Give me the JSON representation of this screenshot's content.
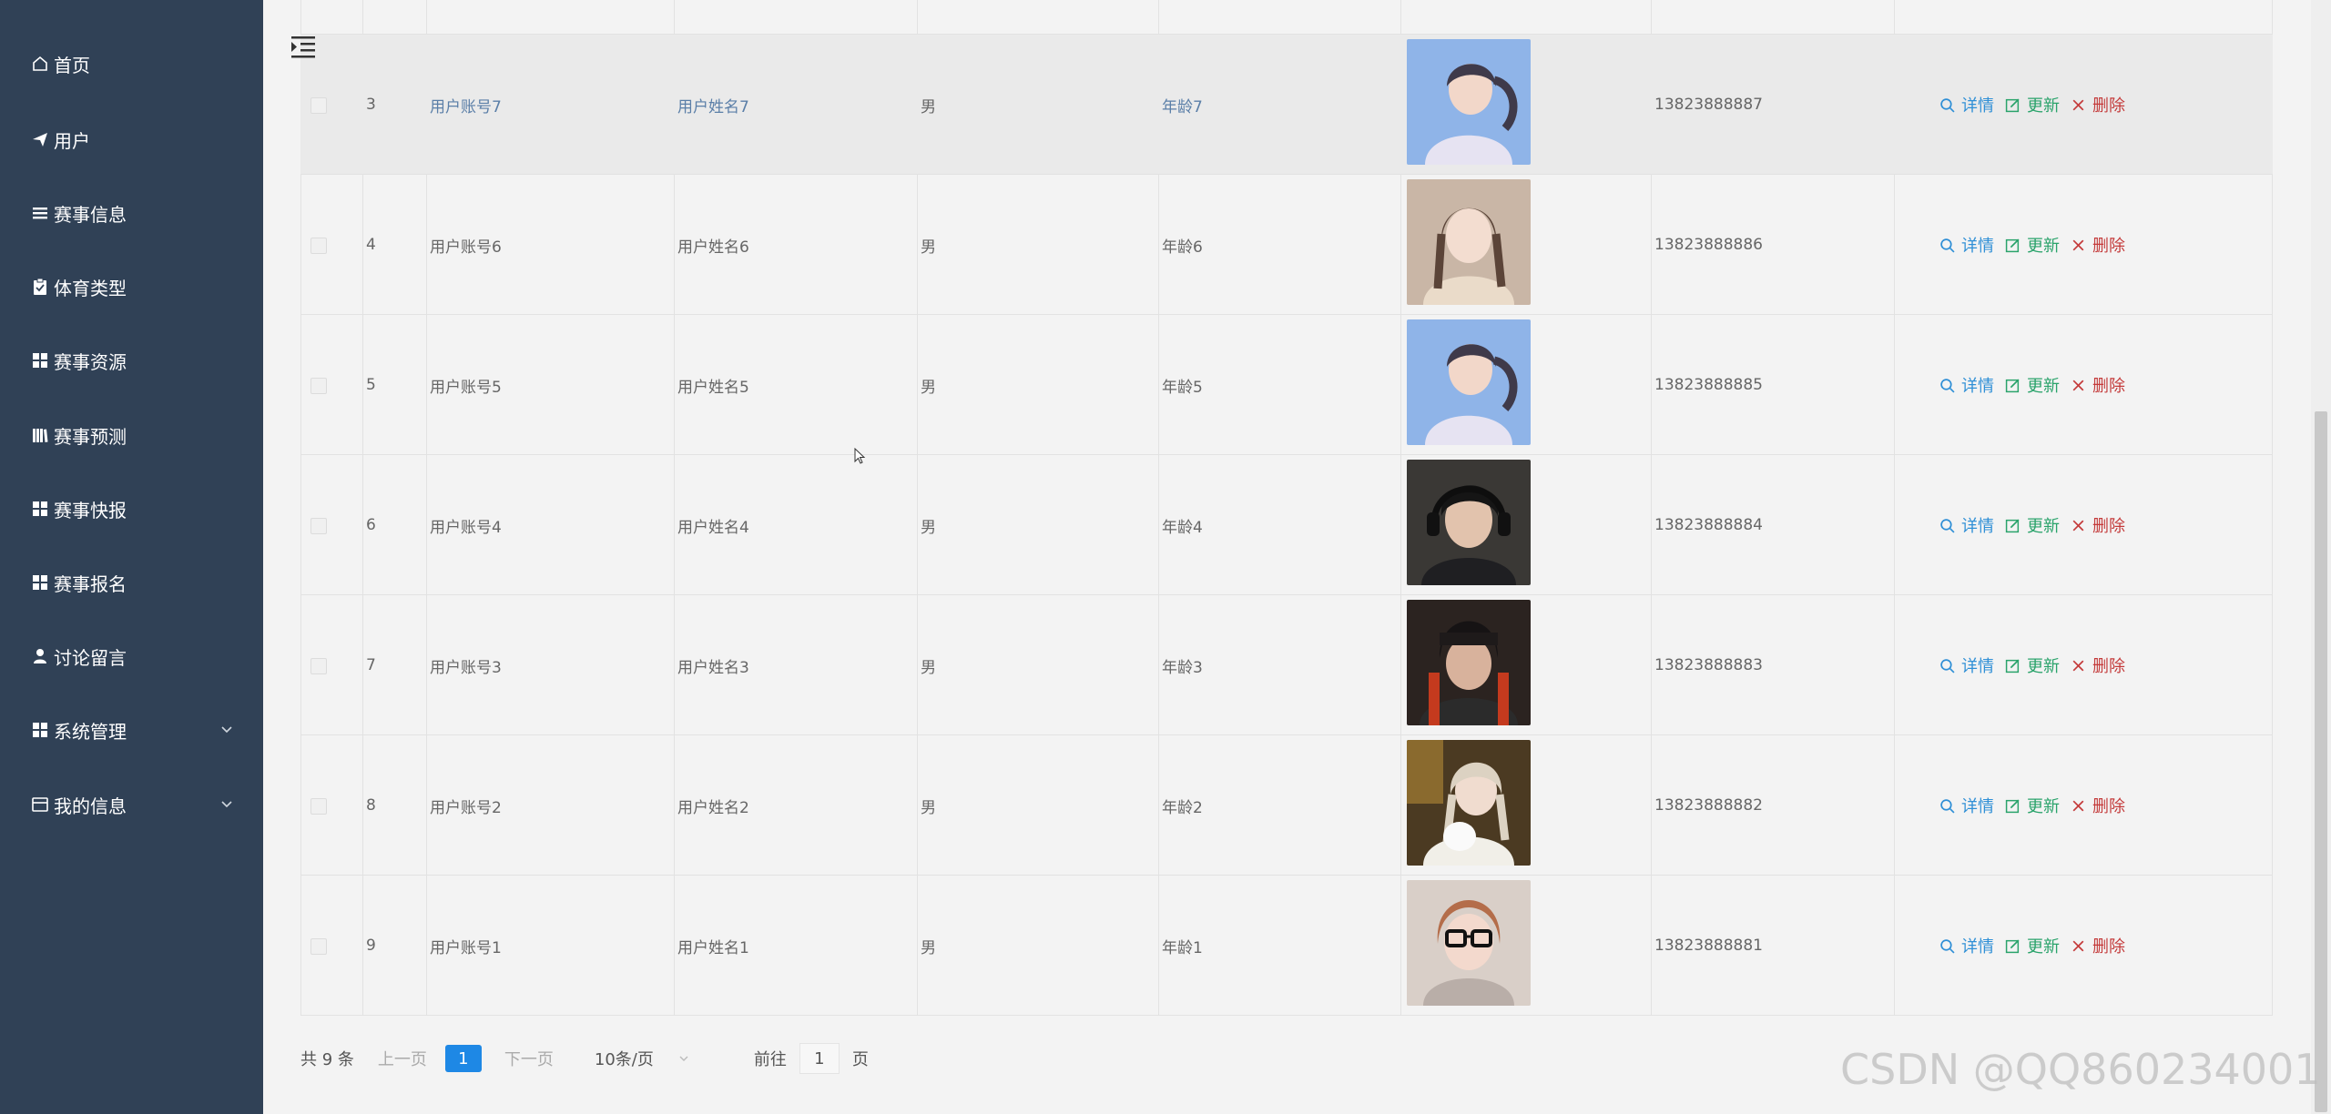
{
  "sidebar": {
    "items": [
      {
        "label": "首页",
        "icon": "home-icon"
      },
      {
        "label": "用户",
        "icon": "send-icon"
      },
      {
        "label": "赛事信息",
        "icon": "list-icon"
      },
      {
        "label": "体育类型",
        "icon": "clipboard-icon"
      },
      {
        "label": "赛事资源",
        "icon": "grid-icon"
      },
      {
        "label": "赛事预测",
        "icon": "book-icon"
      },
      {
        "label": "赛事快报",
        "icon": "grid-icon"
      },
      {
        "label": "赛事报名",
        "icon": "grid-icon"
      },
      {
        "label": "讨论留言",
        "icon": "user-icon"
      },
      {
        "label": "系统管理",
        "icon": "grid-icon",
        "expandable": true
      },
      {
        "label": "我的信息",
        "icon": "window-icon",
        "expandable": true
      }
    ]
  },
  "table": {
    "rows": [
      {
        "index": "3",
        "account": "用户账号7",
        "name": "用户姓名7",
        "gender": "男",
        "age": "年龄7",
        "phone": "13823888887",
        "avatar": "girl-blue",
        "hover": true
      },
      {
        "index": "4",
        "account": "用户账号6",
        "name": "用户姓名6",
        "gender": "男",
        "age": "年龄6",
        "phone": "13823888886",
        "avatar": "girl-beige"
      },
      {
        "index": "5",
        "account": "用户账号5",
        "name": "用户姓名5",
        "gender": "男",
        "age": "年龄5",
        "phone": "13823888885",
        "avatar": "girl-blue"
      },
      {
        "index": "6",
        "account": "用户账号4",
        "name": "用户姓名4",
        "gender": "男",
        "age": "年龄4",
        "phone": "13823888884",
        "avatar": "boy-headphones"
      },
      {
        "index": "7",
        "account": "用户账号3",
        "name": "用户姓名3",
        "gender": "男",
        "age": "年龄3",
        "phone": "13823888883",
        "avatar": "boy-beanie"
      },
      {
        "index": "8",
        "account": "用户账号2",
        "name": "用户姓名2",
        "gender": "男",
        "age": "年龄2",
        "phone": "13823888882",
        "avatar": "girl-cat"
      },
      {
        "index": "9",
        "account": "用户账号1",
        "name": "用户姓名1",
        "gender": "男",
        "age": "年龄1",
        "phone": "13823888881",
        "avatar": "girl-glasses"
      }
    ],
    "actions": {
      "detail": "详情",
      "update": "更新",
      "delete": "删除"
    }
  },
  "pagination": {
    "total": "共 9 条",
    "prev": "上一页",
    "current_page": "1",
    "next": "下一页",
    "page_size": "10条/页",
    "goto_prefix": "前往",
    "goto_value": "1",
    "goto_suffix": "页"
  },
  "watermark": "CSDN @QQ860234001",
  "colors": {
    "sidebar_bg": "#304156",
    "detail": "#2f8fd6",
    "update": "#2aa36b",
    "delete": "#c43a3a",
    "page_active": "#1e88e5"
  }
}
